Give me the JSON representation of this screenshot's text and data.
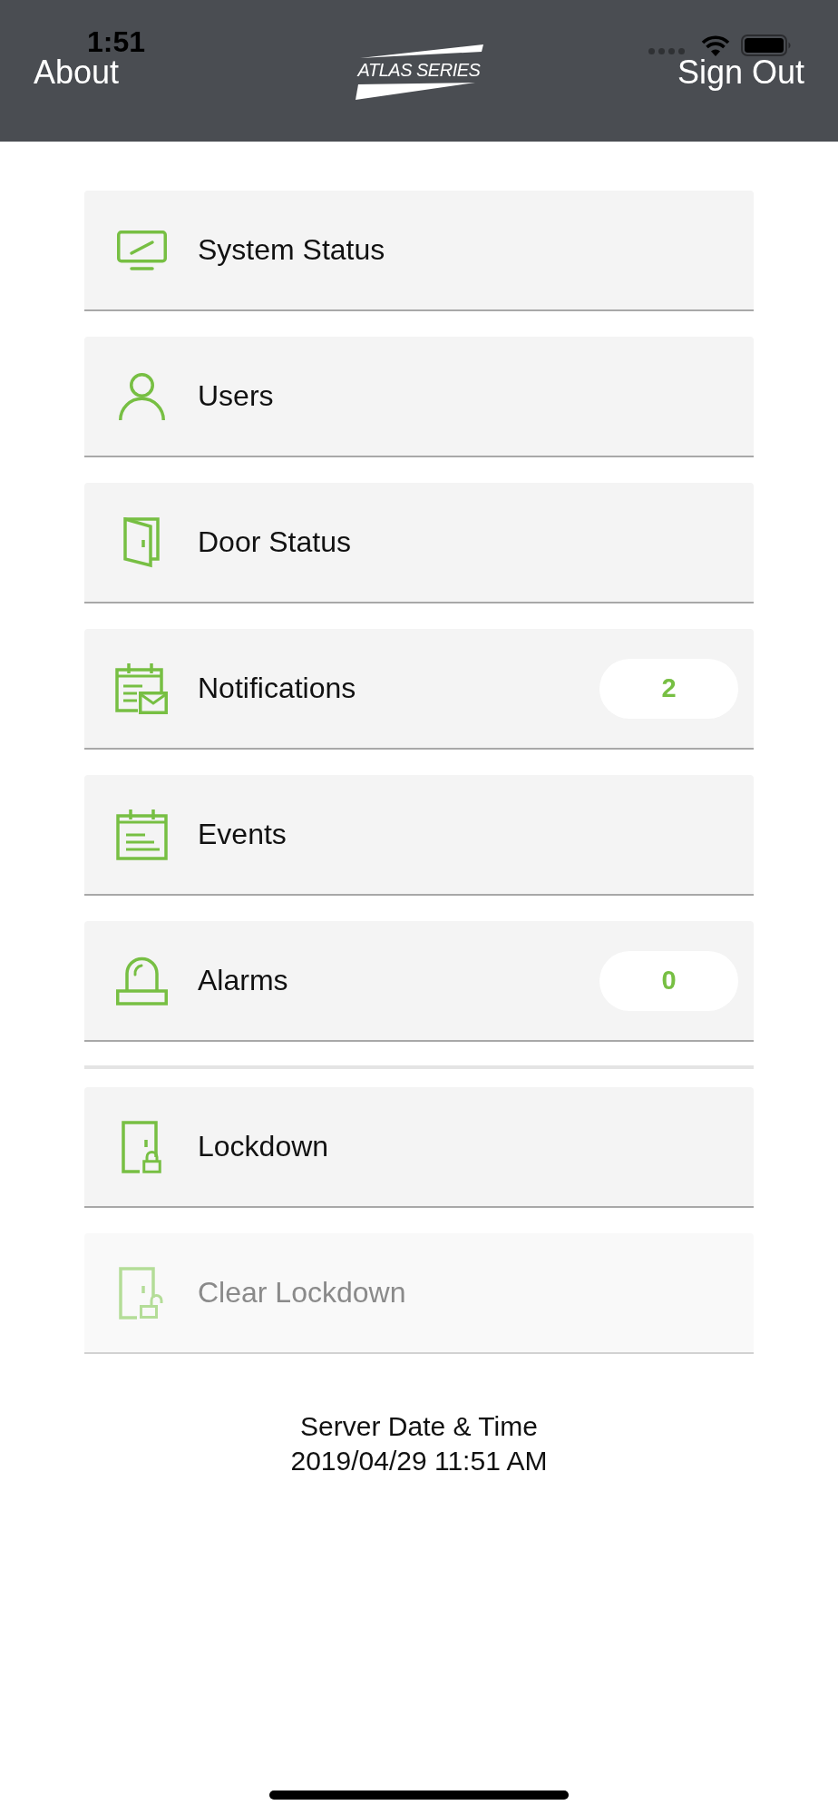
{
  "status_bar": {
    "time": "1:51"
  },
  "nav_bar": {
    "left_button": "About",
    "logo_text": "ATLAS SERIES",
    "right_button": "Sign Out"
  },
  "menu_sections": [
    {
      "items": [
        {
          "label": "System Status",
          "disabled": false
        },
        {
          "label": "Users",
          "disabled": false
        },
        {
          "label": "Door Status",
          "disabled": false
        },
        {
          "label": "Notifications",
          "badge": "2",
          "disabled": false
        },
        {
          "label": "Events",
          "disabled": false
        },
        {
          "label": "Alarms",
          "badge": "0",
          "disabled": false
        }
      ]
    },
    {
      "items": [
        {
          "label": "Lockdown",
          "disabled": false
        },
        {
          "label": "Clear Lockdown",
          "disabled": true
        }
      ]
    }
  ],
  "server_time": {
    "label": "Server Date & Time",
    "value": "2019/04/29 11:51 AM"
  }
}
